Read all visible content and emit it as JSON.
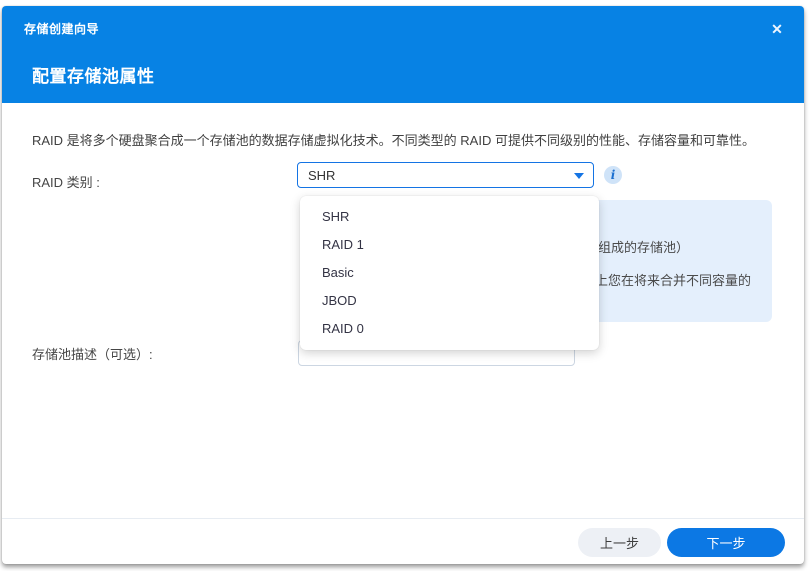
{
  "dialog": {
    "title": "存储创建向导",
    "close_glyph": "✕",
    "heading": "配置存储池属性",
    "description": "RAID 是将多个硬盘聚合成一个存储池的数据存储虚拟化技术。不同类型的 RAID 可提供不同级别的性能、存储容量和可靠性。"
  },
  "form": {
    "raid_type_label": "RAID 类别 :",
    "raid_type_value": "SHR",
    "raid_options": [
      "SHR",
      "RAID 1",
      "Basic",
      "JBOD",
      "RAID 0"
    ],
    "info_icon_glyph": "i",
    "info_box_visible_lines": {
      "line1": "组成的存储池）",
      "line2": "上您在将来合并不同容量的"
    },
    "description_label": "存储池描述（可选）:",
    "description_value": ""
  },
  "footer": {
    "back_label": "上一步",
    "next_label": "下一步"
  },
  "colors": {
    "header_blue": "#0782e4",
    "accent_blue": "#1474e4",
    "info_box_bg": "#e4effc",
    "next_button_bg": "#0c78e4",
    "back_button_bg": "#edf0f5"
  }
}
